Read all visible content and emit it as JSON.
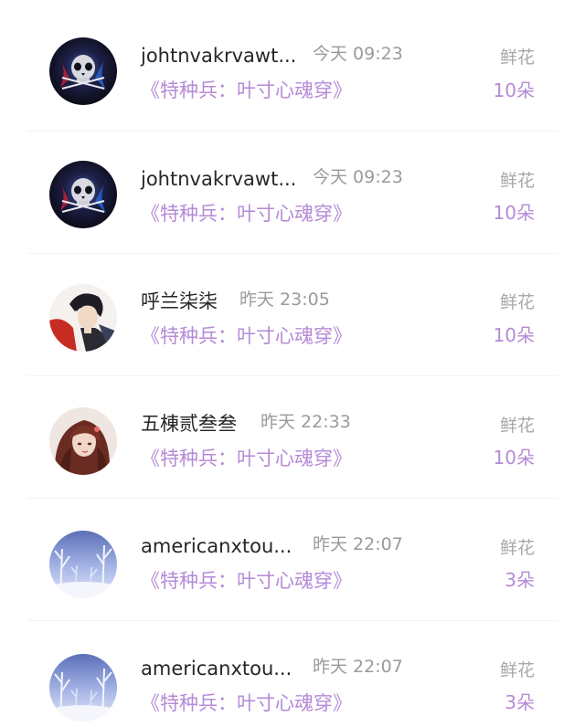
{
  "gift_items": [
    {
      "user": "johtnvakrvawt...",
      "time": "今天 09:23",
      "book": "《特种兵：叶寸心魂穿》",
      "gift_type": "鲜花",
      "quantity": "10朵",
      "avatar": "skull-avatar"
    },
    {
      "user": "johtnvakrvawt...",
      "time": "今天 09:23",
      "book": "《特种兵：叶寸心魂穿》",
      "gift_type": "鲜花",
      "quantity": "10朵",
      "avatar": "skull-avatar"
    },
    {
      "user": "呼兰柒柒",
      "time": "昨天 23:05",
      "book": "《特种兵：叶寸心魂穿》",
      "gift_type": "鲜花",
      "quantity": "10朵",
      "avatar": "anime-boy-avatar"
    },
    {
      "user": "五棟贰叁叁",
      "time": "昨天 22:33",
      "book": "《特种兵：叶寸心魂穿》",
      "gift_type": "鲜花",
      "quantity": "10朵",
      "avatar": "anime-girl-avatar"
    },
    {
      "user": "americanxtou...",
      "time": "昨天 22:07",
      "book": "《特种兵：叶寸心魂穿》",
      "gift_type": "鲜花",
      "quantity": "3朵",
      "avatar": "snowy-forest-avatar"
    },
    {
      "user": "americanxtou...",
      "time": "昨天 22:07",
      "book": "《特种兵：叶寸心魂穿》",
      "gift_type": "鲜花",
      "quantity": "3朵",
      "avatar": "snowy-forest-avatar"
    }
  ],
  "colors": {
    "name": "#262626",
    "time": "#9a9a9a",
    "book": "#b58ad6",
    "quantity": "#b58ad6",
    "gift_type": "#a8a8a8"
  }
}
